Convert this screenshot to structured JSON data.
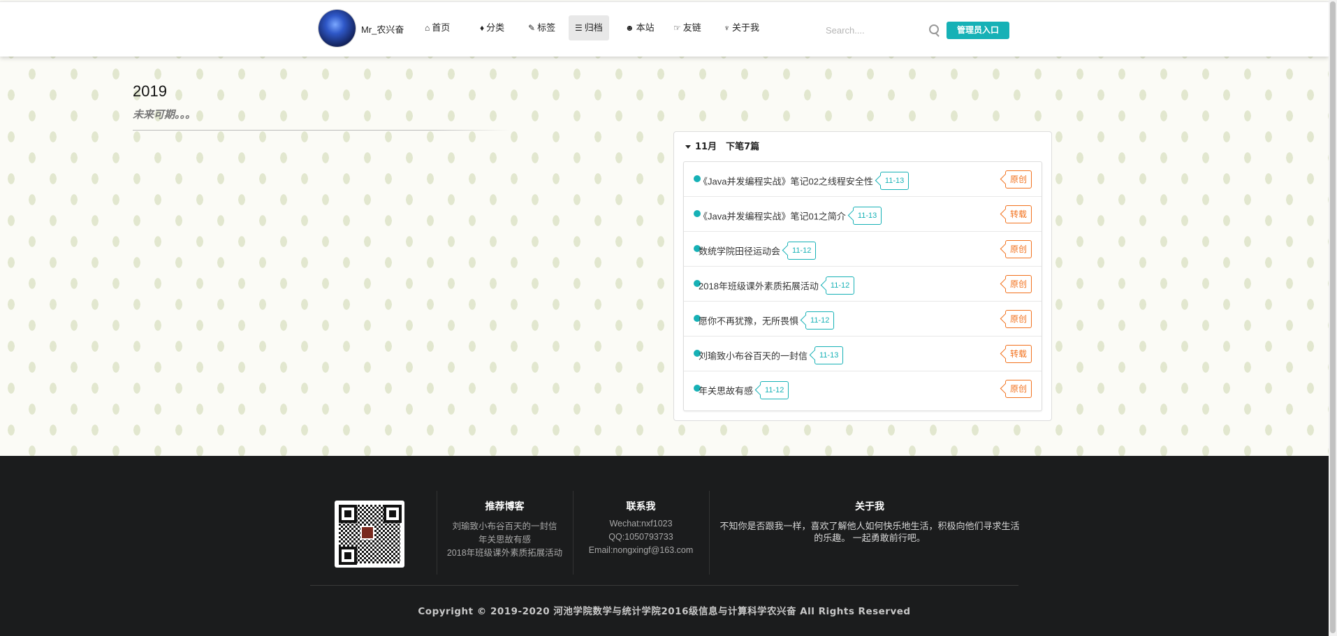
{
  "nav": {
    "brand": "Mr_农兴奋",
    "items": [
      {
        "icon": "home-icon",
        "glyph": "⌂",
        "label": "首页"
      },
      {
        "icon": "idea-icon",
        "glyph": "♦",
        "label": "分类"
      },
      {
        "icon": "tag-icon",
        "glyph": "✎",
        "label": "标签"
      },
      {
        "icon": "archive-icon",
        "glyph": "☰",
        "label": "归档"
      },
      {
        "icon": "info-icon",
        "glyph": "☻",
        "label": "本站"
      },
      {
        "icon": "handshake-icon",
        "glyph": "☞",
        "label": "友链"
      },
      {
        "icon": "about-icon",
        "glyph": "♆",
        "label": "关于我"
      }
    ],
    "search_placeholder": "Search....",
    "admin_label": "管理员入口"
  },
  "archive": {
    "year": "2019",
    "subtitle": "未来可期。。。",
    "month_header": "11月　下笔7篇",
    "articles": [
      {
        "title": "《Java并发编程实战》笔记02之线程安全性",
        "date": "11-13",
        "type": "原创"
      },
      {
        "title": "《Java并发编程实战》笔记01之简介",
        "date": "11-13",
        "type": "转载"
      },
      {
        "title": "数统学院田径运动会",
        "date": "11-12",
        "type": "原创"
      },
      {
        "title": "2018年班级课外素质拓展活动",
        "date": "11-12",
        "type": "原创"
      },
      {
        "title": "愿你不再犹豫，无所畏惧",
        "date": "11-12",
        "type": "原创"
      },
      {
        "title": "刘瑜致小布谷百天的一封信",
        "date": "11-13",
        "type": "转载"
      },
      {
        "title": "年关思故有感",
        "date": "11-12",
        "type": "原创"
      }
    ]
  },
  "footer": {
    "recommend": {
      "title": "推荐博客",
      "lines": [
        "刘瑜致小布谷百天的一封信",
        "年关思故有感",
        "2018年班级课外素质拓展活动"
      ]
    },
    "contact": {
      "title": "联系我",
      "lines": [
        "Wechat:nxf1023",
        "QQ:1050793733",
        "Email:nongxingf@163.com"
      ]
    },
    "about": {
      "title": "关于我",
      "text": "不知你是否跟我一样，喜欢了解他人如何快乐地生活，积极向他们寻求生活的乐趣。 一起勇敢前行吧。"
    },
    "copyright": "Copyright © 2019-2020 河池学院数学与统计学院2016级信息与计算科学农兴奋 All Rights Reserved"
  },
  "colors": {
    "accent": "#16b1b6",
    "original_tag": "#f2711c",
    "footer_bg": "#1b1c1d"
  }
}
